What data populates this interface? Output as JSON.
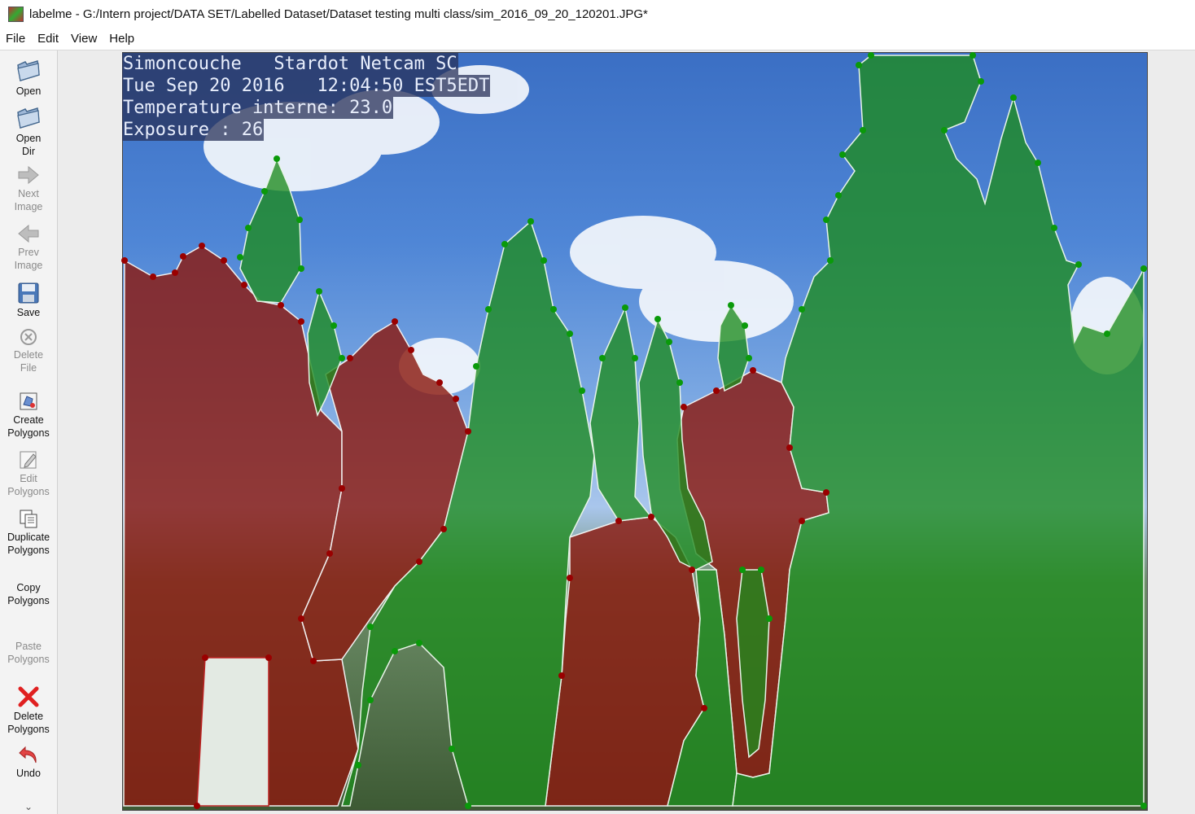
{
  "window": {
    "title": "labelme - G:/Intern project/DATA SET/Labelled Dataset/Dataset testing multi class/sim_2016_09_20_120201.JPG*"
  },
  "menu": [
    "File",
    "Edit",
    "View",
    "Help"
  ],
  "toolbar": {
    "open": "Open",
    "open_dir_1": "Open",
    "open_dir_2": "Dir",
    "next_1": "Next",
    "next_2": "Image",
    "prev_1": "Prev",
    "prev_2": "Image",
    "save": "Save",
    "delete_file_1": "Delete",
    "delete_file_2": "File",
    "create_1": "Create",
    "create_2": "Polygons",
    "edit_1": "Edit",
    "edit_2": "Polygons",
    "dup_1": "Duplicate",
    "dup_2": "Polygons",
    "copy_1": "Copy",
    "copy_2": "Polygons",
    "paste_1": "Paste",
    "paste_2": "Polygons",
    "delpoly_1": "Delete",
    "delpoly_2": "Polygons",
    "undo": "Undo"
  },
  "image_overlay": {
    "line1": "Simoncouche   Stardot Netcam SC",
    "line2": "Tue Sep 20 2016   12:04:50 EST5EDT",
    "line3": "Temperature interne: 23.0",
    "line4": "Exposure : 26"
  },
  "colors": {
    "tree_label": "#1e8c1e",
    "tree_vertex": "#0a9a0a",
    "other_label": "#8b1a10",
    "other_vertex": "#9a0000"
  }
}
